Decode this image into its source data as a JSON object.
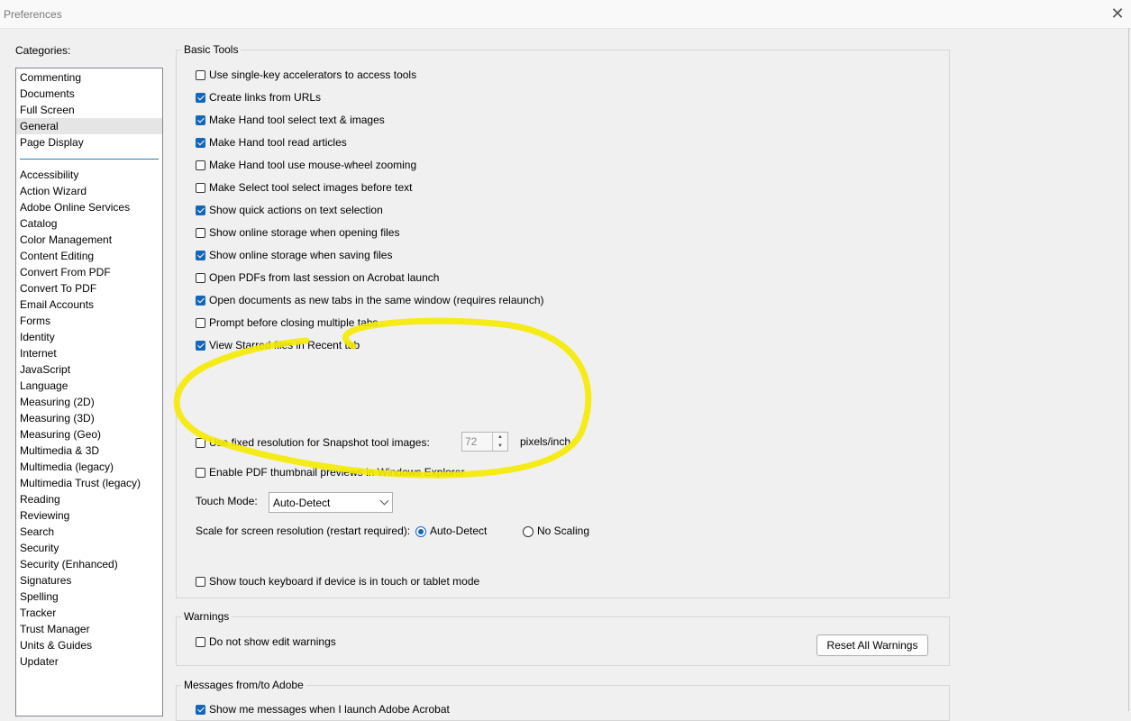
{
  "window": {
    "title": "Preferences"
  },
  "categories": {
    "label": "Categories:",
    "top_items": [
      "Commenting",
      "Documents",
      "Full Screen",
      "General",
      "Page Display"
    ],
    "selected": "General",
    "items": [
      "Accessibility",
      "Action Wizard",
      "Adobe Online Services",
      "Catalog",
      "Color Management",
      "Content Editing",
      "Convert From PDF",
      "Convert To PDF",
      "Email Accounts",
      "Forms",
      "Identity",
      "Internet",
      "JavaScript",
      "Language",
      "Measuring (2D)",
      "Measuring (3D)",
      "Measuring (Geo)",
      "Multimedia & 3D",
      "Multimedia (legacy)",
      "Multimedia Trust (legacy)",
      "Reading",
      "Reviewing",
      "Search",
      "Security",
      "Security (Enhanced)",
      "Signatures",
      "Spelling",
      "Tracker",
      "Trust Manager",
      "Units & Guides",
      "Updater"
    ]
  },
  "basic_tools": {
    "title": "Basic Tools",
    "options": [
      {
        "label": "Use single-key accelerators to access tools",
        "checked": false
      },
      {
        "label": "Create links from URLs",
        "checked": true
      },
      {
        "label": "Make Hand tool select text & images",
        "checked": true
      },
      {
        "label": "Make Hand tool read articles",
        "checked": true
      },
      {
        "label": "Make Hand tool use mouse-wheel zooming",
        "checked": false
      },
      {
        "label": "Make Select tool select images before text",
        "checked": false
      },
      {
        "label": "Show quick actions on text selection",
        "checked": true
      },
      {
        "label": "Show online storage when opening files",
        "checked": false
      },
      {
        "label": "Show online storage when saving files",
        "checked": true
      },
      {
        "label": "Open PDFs from last session on Acrobat launch",
        "checked": false
      },
      {
        "label": "Open documents as new tabs in the same window (requires relaunch)",
        "checked": true
      },
      {
        "label": "Prompt before closing multiple tabs",
        "checked": false
      },
      {
        "label": "View Starred files in Recent tab",
        "checked": true
      }
    ],
    "snapshot": {
      "label": "Use fixed resolution for Snapshot tool images:",
      "checked": false,
      "value": "72",
      "unit": "pixels/inch"
    },
    "thumbnail": {
      "label": "Enable PDF thumbnail previews in Windows Explorer",
      "checked": false
    },
    "touch_mode": {
      "label": "Touch Mode:",
      "value": "Auto-Detect"
    },
    "scale": {
      "label": "Scale for screen resolution (restart required):",
      "options": [
        "Auto-Detect",
        "No Scaling"
      ],
      "selected": "Auto-Detect"
    },
    "touch_keyboard": {
      "label": "Show touch keyboard if device is in touch or tablet mode",
      "checked": false
    }
  },
  "warnings": {
    "title": "Warnings",
    "option": {
      "label": "Do not show edit warnings",
      "checked": false
    },
    "reset_button": "Reset All Warnings"
  },
  "messages": {
    "title": "Messages from/to Adobe",
    "option": {
      "label": "Show me messages when I launch Adobe Acrobat",
      "checked": true
    }
  },
  "annotation": {
    "color": "#f5ea00"
  },
  "colors": {
    "accent": "#1467b8",
    "separator": "#2b7ab8"
  }
}
